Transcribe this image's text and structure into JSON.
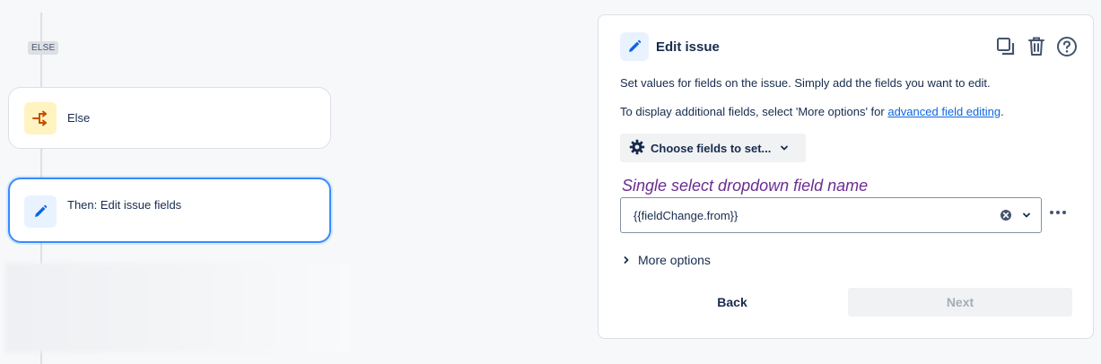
{
  "flow": {
    "else_tag": "ELSE",
    "else_card": {
      "label": "Else",
      "icon": "branch-icon",
      "icon_color": "#c25100"
    },
    "action_card": {
      "label": "Then: Edit issue fields",
      "icon": "pencil-icon",
      "icon_color": "#0c66e4"
    }
  },
  "panel": {
    "title": "Edit issue",
    "header_icons": [
      "duplicate-icon",
      "trash-icon",
      "help-icon"
    ],
    "description_1": "Set values for fields on the issue. Simply add the fields you want to edit.",
    "description_2_prefix": "To display additional fields, select 'More options' for ",
    "description_2_link": "advanced field editing",
    "description_2_suffix": ".",
    "choose_fields_label": "Choose fields to set...",
    "field_label": "Single select dropdown field name",
    "field_value": "{{fieldChange.from}}",
    "more_options_label": "More options",
    "back_label": "Back",
    "next_label": "Next"
  },
  "colors": {
    "accent": "#388bff",
    "link": "#0c66e4",
    "field_label": "#6a2c91",
    "disabled_text": "#a5adba"
  }
}
